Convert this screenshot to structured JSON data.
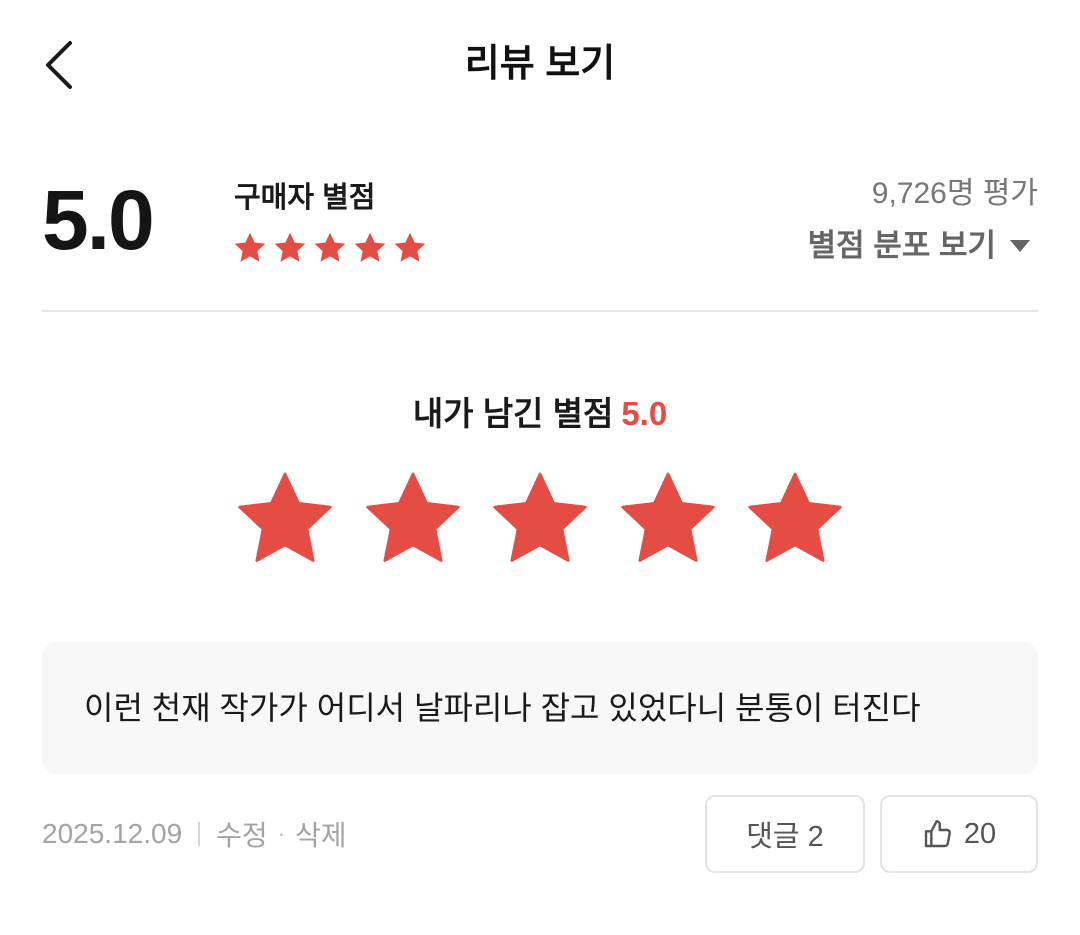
{
  "header": {
    "title": "리뷰 보기",
    "back_icon": "chevron-left-icon"
  },
  "summary": {
    "average": "5.0",
    "buyer_label": "구매자 별점",
    "star_count": 5,
    "rating_count": "9,726명 평가",
    "distribution_label": "별점 분포 보기"
  },
  "my_rating": {
    "label": "내가 남긴 별점",
    "score": "5.0",
    "stars": 5
  },
  "review": {
    "text": "이런 천재 작가가 어디서 날파리나 잡고 있었다니 분통이 터진다",
    "date": "2025.12.09",
    "edit_label": "수정",
    "delete_label": "삭제",
    "comment_label": "댓글 2",
    "like_count": "20"
  },
  "colors": {
    "accent": "#e44c44",
    "muted": "#a3a3a3",
    "box_bg": "#f8f8f8"
  }
}
